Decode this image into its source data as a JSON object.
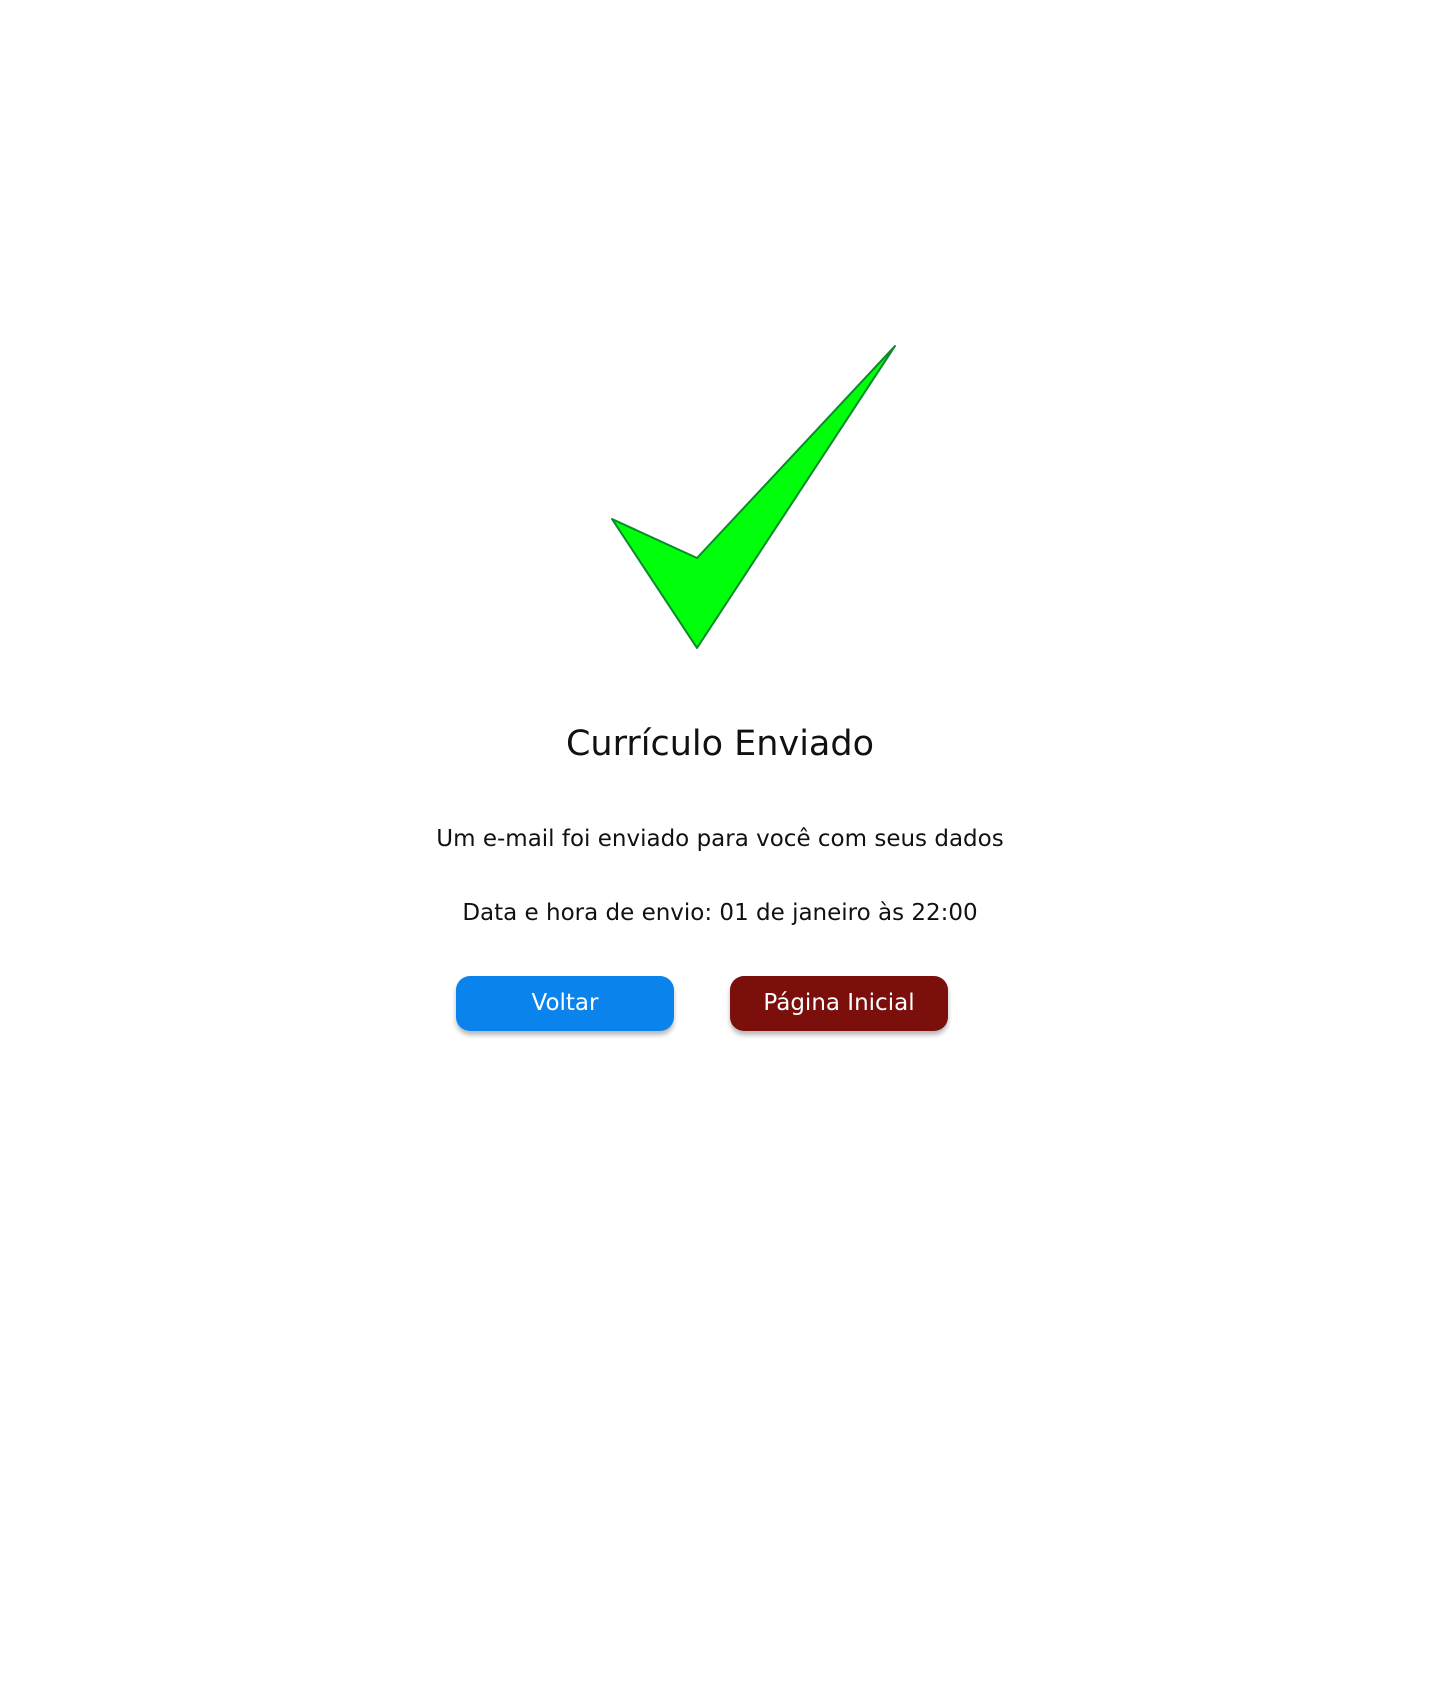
{
  "confirmation": {
    "icon": "checkmark-icon",
    "icon_fill": "#00ff0a",
    "icon_stroke": "#0a8a2a",
    "title": "Currículo Enviado",
    "message": "Um e-mail foi enviado para você com seus dados",
    "sent_info": "Data e hora de envio: 01 de janeiro às 22:00"
  },
  "actions": {
    "back_label": "Voltar",
    "back_color": "#0a83ec",
    "home_label": "Página Inicial",
    "home_color": "#7a0f0c"
  }
}
